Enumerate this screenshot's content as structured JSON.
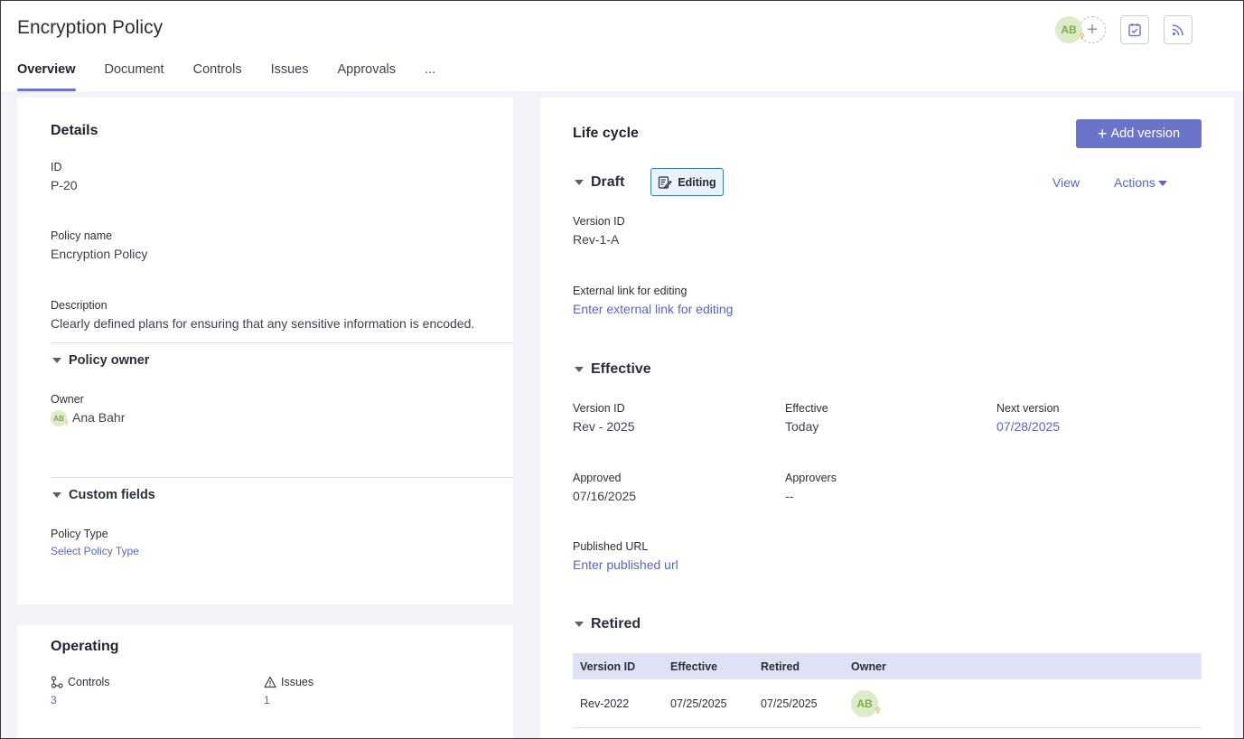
{
  "header": {
    "title": "Encryption Policy",
    "tabs": [
      {
        "label": "Overview",
        "active": true
      },
      {
        "label": "Document"
      },
      {
        "label": "Controls"
      },
      {
        "label": "Issues"
      },
      {
        "label": "Approvals"
      },
      {
        "label": "..."
      }
    ],
    "avatar_initials": "AB",
    "icons": [
      "add-person-icon",
      "task-calendar-icon",
      "rss-feed-icon"
    ]
  },
  "details": {
    "title": "Details",
    "id_label": "ID",
    "id_value": "P-20",
    "name_label": "Policy name",
    "name_value": "Encryption Policy",
    "desc_label": "Description",
    "desc_value": "Clearly defined plans for ensuring that any sensitive information is encoded.",
    "owner_section": "Policy owner",
    "owner_label": "Owner",
    "owner_initials": "AB",
    "owner_name": "Ana Bahr",
    "custom_section": "Custom fields",
    "policy_type_label": "Policy Type",
    "policy_type_link": "Select Policy Type"
  },
  "operating": {
    "title": "Operating",
    "controls_label": "Controls",
    "controls_count": "3",
    "issues_label": "Issues",
    "issues_count": "1"
  },
  "lifecycle": {
    "title": "Life cycle",
    "add_version": "Add version",
    "draft": {
      "title": "Draft",
      "badge": "Editing",
      "view": "View",
      "actions": "Actions",
      "version_label": "Version ID",
      "version_value": "Rev-1-A",
      "ext_label": "External link for editing",
      "ext_link": "Enter external link for editing"
    },
    "effective": {
      "title": "Effective",
      "version_label": "Version ID",
      "version_value": "Rev - 2025",
      "effective_label": "Effective",
      "effective_value": "Today",
      "next_label": "Next version",
      "next_value": "07/28/2025",
      "approved_label": "Approved",
      "approved_value": "07/16/2025",
      "approvers_label": "Approvers",
      "approvers_value": "--",
      "url_label": "Published URL",
      "url_link": "Enter published url"
    },
    "retired": {
      "title": "Retired",
      "columns": [
        "Version ID",
        "Effective",
        "Retired",
        "Owner"
      ],
      "rows": [
        {
          "version": "Rev-2022",
          "effective": "07/25/2025",
          "retired": "07/25/2025",
          "owner_initials": "AB"
        }
      ]
    }
  },
  "colors": {
    "accent": "#6b74c9",
    "link": "#5865c0",
    "avatar_bg": "#dcebc8",
    "avatar_text": "#7cab4a",
    "key": "#f0a63a"
  }
}
